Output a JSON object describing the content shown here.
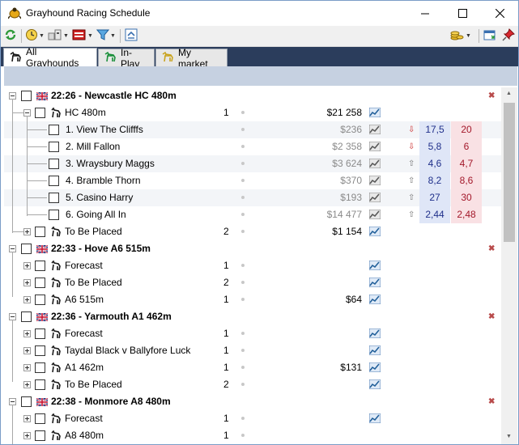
{
  "window": {
    "title": "Grayhound Racing Schedule"
  },
  "controls": {
    "minimize": "—",
    "maximize": "☐",
    "close": "✕"
  },
  "tabs": [
    {
      "label": "All Grayhounds",
      "icon": "greyhound-icon",
      "icon_color": "#1a1a1a",
      "active": true
    },
    {
      "label": "In-Play",
      "icon": "greyhound-icon",
      "icon_color": "#1a8f3a",
      "active": false
    },
    {
      "label": "My market",
      "icon": "greyhound-icon",
      "icon_color": "#c9a420",
      "active": false
    }
  ],
  "events": [
    {
      "time": "22:26 - Newcastle HC 480m",
      "markets": [
        {
          "name": "HC 480m",
          "winners": "1",
          "matched": "$21 258",
          "runners": [
            {
              "name": "1. View The Clifffs",
              "matched": "$236",
              "trend": "down",
              "back": "17,5",
              "lay": "20"
            },
            {
              "name": "2. Mill Fallon",
              "matched": "$2 358",
              "trend": "down",
              "back": "5,8",
              "lay": "6"
            },
            {
              "name": "3. Wraysbury Maggs",
              "matched": "$3 624",
              "trend": "up",
              "back": "4,6",
              "lay": "4,7"
            },
            {
              "name": "4. Bramble Thorn",
              "matched": "$370",
              "trend": "up",
              "back": "8,2",
              "lay": "8,6"
            },
            {
              "name": "5. Casino Harry",
              "matched": "$193",
              "trend": "up",
              "back": "27",
              "lay": "30"
            },
            {
              "name": "6. Going All In",
              "matched": "$14 477",
              "trend": "up",
              "back": "2,44",
              "lay": "2,48"
            }
          ]
        },
        {
          "name": "To Be Placed",
          "winners": "2",
          "matched": "$1 154"
        }
      ]
    },
    {
      "time": "22:33 - Hove A6 515m",
      "markets": [
        {
          "name": "Forecast",
          "winners": "1",
          "matched": ""
        },
        {
          "name": "To Be Placed",
          "winners": "2",
          "matched": ""
        },
        {
          "name": "A6 515m",
          "winners": "1",
          "matched": "$64"
        }
      ]
    },
    {
      "time": "22:36 - Yarmouth A1 462m",
      "markets": [
        {
          "name": "Forecast",
          "winners": "1",
          "matched": ""
        },
        {
          "name": "Taydal Black v Ballyfore Luck",
          "winners": "1",
          "matched": ""
        },
        {
          "name": "A1 462m",
          "winners": "1",
          "matched": "$131"
        },
        {
          "name": "To Be Placed",
          "winners": "2",
          "matched": ""
        }
      ]
    },
    {
      "time": "22:38 - Monmore A8 480m",
      "markets": [
        {
          "name": "Forecast",
          "winners": "1",
          "matched": ""
        },
        {
          "name": "A8 480m",
          "winners": "1",
          "matched": ""
        }
      ]
    }
  ],
  "colors": {
    "back": "#dfe6f7",
    "lay": "#f9e1e4",
    "tabstrip": "#2b3d5c",
    "header_band": "#c6d1e1"
  }
}
